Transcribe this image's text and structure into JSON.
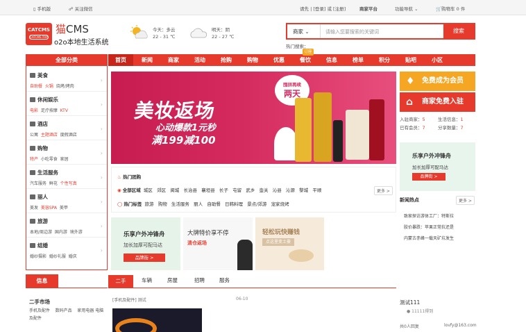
{
  "topbar": {
    "mobile": "手机版",
    "wechat": "关注微信",
    "greeting": "请先",
    "login": "登录",
    "or": "或",
    "register": "注册",
    "merchant": "商家平台",
    "functions": "功能导航",
    "cart": "购物车",
    "cart_count": "0 件"
  },
  "logo": {
    "text": "CATCMS",
    "sub": "CATCMS.TOP"
  },
  "brand": {
    "cat": "猫",
    "cms": "CMS",
    "slogan": "o2o本地生活系统"
  },
  "weather": {
    "today_label": "今天：多云",
    "today_temp": "22 - 31 ℃",
    "tomorrow_label": "明天：阴",
    "tomorrow_temp": "22 - 27 ℃"
  },
  "search": {
    "category": "商家",
    "placeholder": "请输入您要搜索的关键词",
    "button": "搜索",
    "hot_label": "热门搜索："
  },
  "nav": {
    "all_categories": "全部分类",
    "items": [
      "首页",
      "新闻",
      "商家",
      "活动",
      "抢购",
      "购物",
      "优惠",
      "餐饮",
      "信息",
      "榜单",
      "积分",
      "贴吧",
      "小区"
    ],
    "hot_tag": "订座"
  },
  "categories": [
    {
      "title": "美食",
      "subs": [
        "自助餐",
        "火锅",
        "烧烤/烤肉"
      ]
    },
    {
      "title": "休闲娱乐",
      "subs": [
        "电影",
        "足疗按摩",
        "KTV"
      ]
    },
    {
      "title": "酒店",
      "subs": [
        "公寓",
        "主题酒店",
        "度假酒店"
      ]
    },
    {
      "title": "购物",
      "subs": [
        "特产",
        "小吃零食",
        "家居"
      ]
    },
    {
      "title": "生活服务",
      "subs": [
        "汽车服务",
        "鲜花",
        "个性写真"
      ]
    },
    {
      "title": "丽人",
      "subs": [
        "美发",
        "美容SPA",
        "美甲"
      ]
    },
    {
      "title": "旅游",
      "subs": [
        "本地/周边游",
        "国内游",
        "境外游"
      ]
    },
    {
      "title": "结婚",
      "subs": [
        "婚纱摄影",
        "婚纱礼服",
        "婚庆"
      ]
    }
  ],
  "banner": {
    "title": "美妆返场",
    "line2": "心动爆款1元秒",
    "line3": "满199减100",
    "tag1": "囤拼再续",
    "tag2": "两天"
  },
  "hot": {
    "groupbuy": "热门团购",
    "area_label": "全部区域",
    "areas": [
      "城区",
      "郊区",
      "阆城",
      "长治县",
      "襄垣县",
      "长子",
      "屯留",
      "武乡",
      "壶关",
      "沁县",
      "沁源",
      "黎城",
      "平顺"
    ],
    "tags_label": "热门标签",
    "tags": [
      "旅游",
      "购物",
      "生活服务",
      "丽人",
      "自助餐",
      "日韩料理",
      "景点/郊游",
      "宠家烧烤"
    ],
    "more": "更多 >"
  },
  "tiles": [
    {
      "t1": "乐享户外冲锋舟",
      "t2": "加长加厚可配马达",
      "btn": "品牌街 >"
    },
    {
      "t1": "大牌特价享不停",
      "t2": "清仓返场"
    },
    {
      "t1": "轻松玩快赚钱",
      "t2": "点这里变土豪"
    }
  ],
  "right": {
    "member_btn": "免费成为会员",
    "merchant_btn": "商家免费入驻",
    "stats": [
      {
        "k": "入驻商家：",
        "v": "5"
      },
      {
        "k": "生活信息：",
        "v": "1"
      },
      {
        "k": "已有会员：",
        "v": "7"
      },
      {
        "k": "分享数量：",
        "v": "7"
      }
    ],
    "ad": {
      "t1": "乐享户外冲锋舟",
      "t2": "加长加厚可配马达",
      "btn": "品牌街 >"
    },
    "news_title": "新闻热点",
    "news_more": "更多 >",
    "news": [
      "致家探访游体工厂：特斯拉",
      "胶价暴跌：苹果正常抗还是",
      "内蒙古赤峰一载天矿坑发生"
    ]
  },
  "bottom": {
    "info_tab": "信息",
    "info_title": "二手市场",
    "info_links": [
      "手机及配件",
      "数码产品",
      "家用电器",
      "电脑及配件"
    ],
    "tabs": [
      "二手",
      "车辆",
      "房屋",
      "招聘",
      "服务"
    ],
    "post_title": "[手机及配件] 测试",
    "post_date": "06-10",
    "side_title": "测试111",
    "side_sub": "11111得到",
    "side_reply": "共0人回复",
    "side_email": "lovfy@163.com"
  },
  "colors": {
    "brand": "#e53a2c",
    "dark_red": "#c8261a",
    "green": "#2db84b",
    "orange": "#f5a623"
  }
}
